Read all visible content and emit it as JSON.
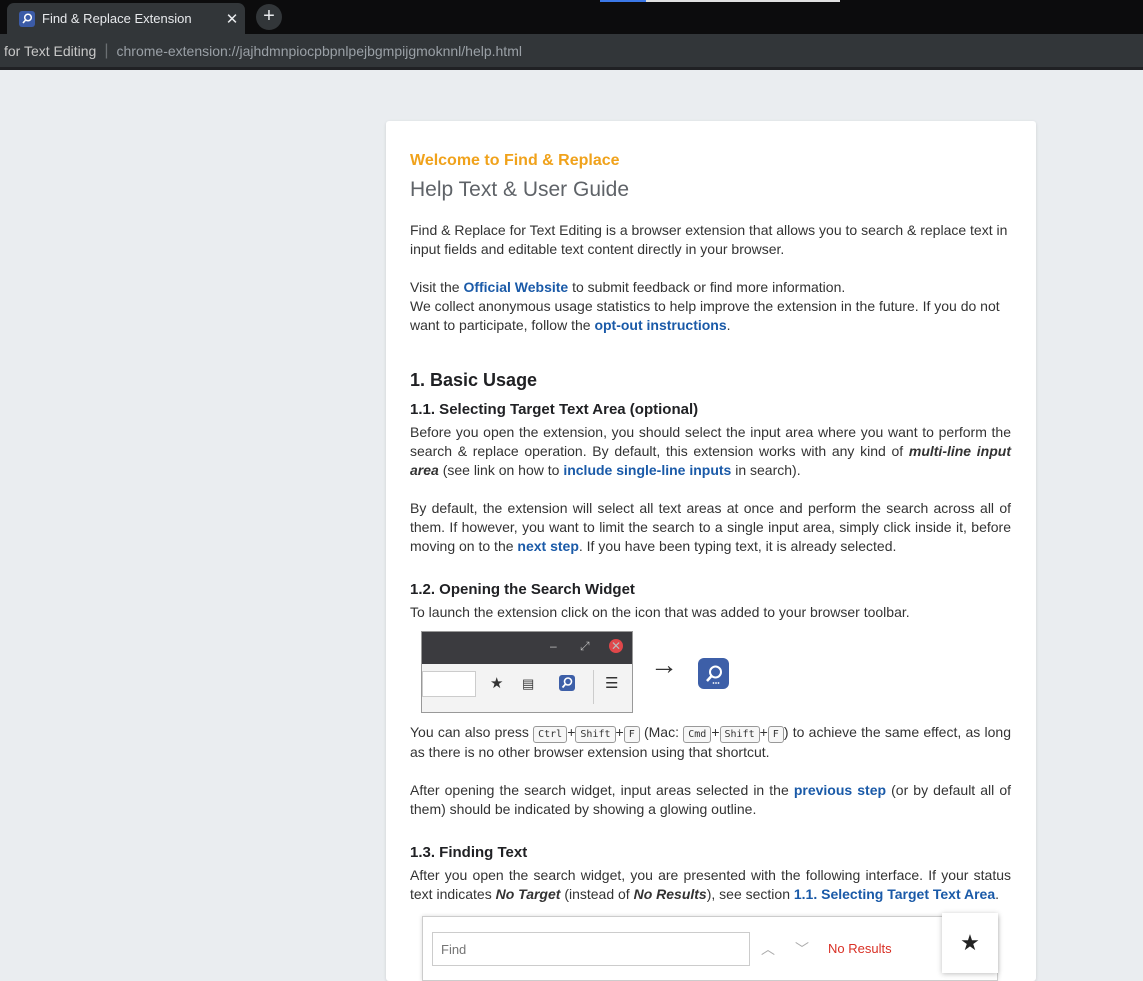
{
  "browser": {
    "tab_title": "Find & Replace Extension",
    "tab_close": "✕",
    "new_tab": "+",
    "site_label": "for Text Editing",
    "url": "chrome-extension://jajhdmnpiocpbpnlpejbgmpijgmoknnl/help.html"
  },
  "page": {
    "welcome": "Welcome to Find & Replace",
    "subtitle": "Help Text & User Guide",
    "intro": "Find & Replace for Text Editing is a browser extension that allows you to search & replace text in input fields and editable text content directly in your browser.",
    "visit_prefix": "Visit the ",
    "official_website": "Official Website",
    "visit_suffix": " to submit feedback or find more information.",
    "stats_text": "We collect anonymous usage statistics to help improve the extension in the future. If you do not want to participate, follow the ",
    "optout_link": "opt-out instructions",
    "stats_end": ".",
    "section1_title": "1. Basic Usage",
    "s11_title": "1.1. Selecting Target Text Area (optional)",
    "s11_p1_a": "Before you open the extension, you should select the input area where you want to perform the search & replace operation. By default, this extension works with any kind of ",
    "s11_p1_em": "multi-line input area",
    "s11_p1_b": " (see link on how to ",
    "s11_p1_link": "include single-line inputs",
    "s11_p1_c": " in search).",
    "s11_p2_a": "By default, the extension will select all text areas at once and perform the search across all of them. If however, you want to limit the search to a single input area, simply click inside it, before moving on to the ",
    "s11_p2_link": "next step",
    "s11_p2_b": ". If you have been typing text, it is already selected.",
    "s12_title": "1.2. Opening the Search Widget",
    "s12_p1": "To launch the extension click on the icon that was added to your browser toolbar.",
    "s12_p2_a": "You can also press ",
    "key_ctrl": "Ctrl",
    "key_shift": "Shift",
    "key_f": "F",
    "key_cmd": "Cmd",
    "plus": "+",
    "mac_open": " (Mac: ",
    "s12_p2_b": ") to achieve the same effect, as long as there is no other browser extension using that shortcut.",
    "s12_p3_a": "After opening the search widget, input areas selected in the ",
    "s12_p3_link": "previous step",
    "s12_p3_b": " (or by default all of them) should be indicated by showing a glowing outline.",
    "s13_title": "1.3. Finding Text",
    "s13_p1_a": "After you open the search widget, you are presented with the following interface. If your status text indicates ",
    "s13_no_target": "No Target",
    "s13_p1_b": " (instead of ",
    "s13_no_results": "No Results",
    "s13_p1_c": "), see section ",
    "s13_link": "1.1. Selecting Target Text Area",
    "s13_p1_d": "."
  },
  "widget": {
    "find_placeholder": "Find",
    "status": "No Results"
  }
}
